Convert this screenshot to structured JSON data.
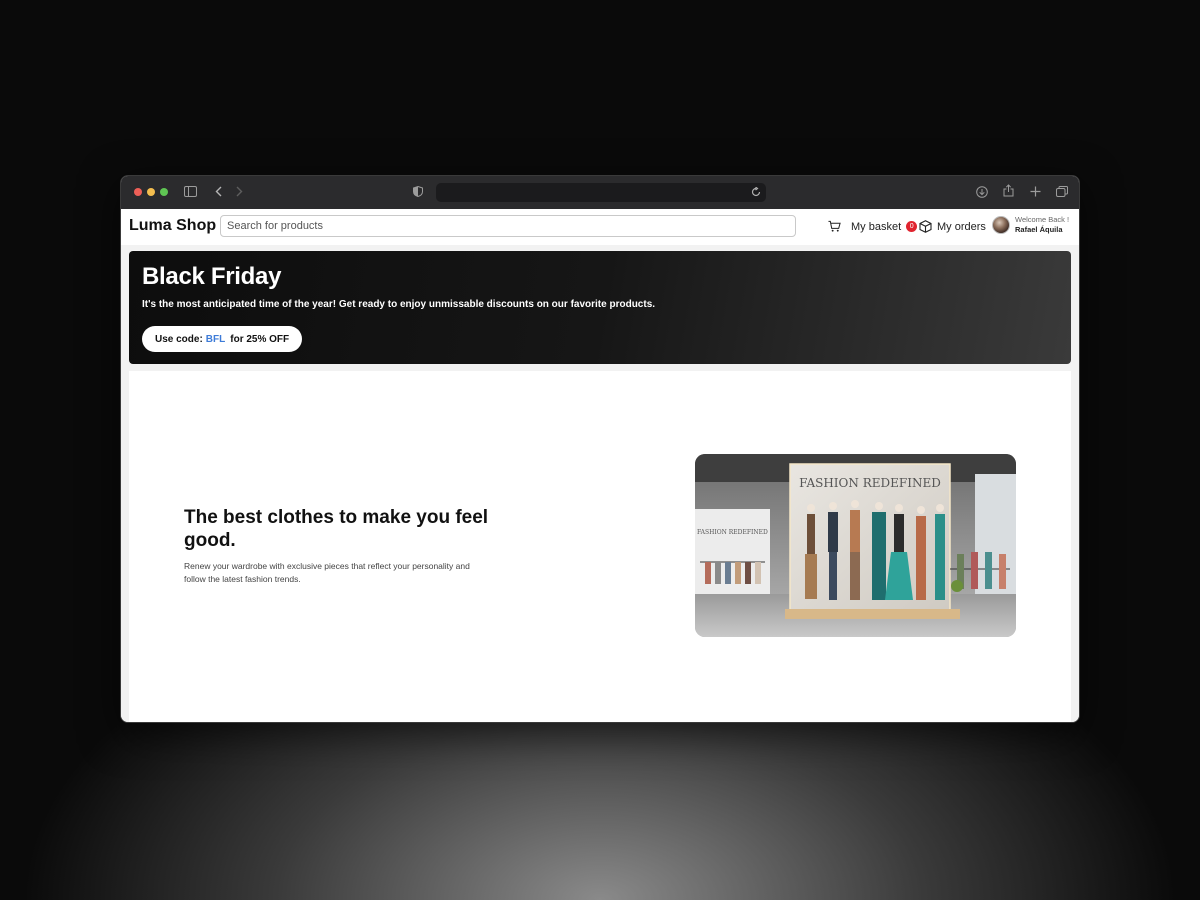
{
  "browser": {
    "controls": [
      "sidebar-icon",
      "back-icon",
      "forward-icon",
      "shield-icon",
      "reload-icon",
      "download-icon",
      "share-icon",
      "plus-icon",
      "tabs-icon"
    ]
  },
  "nav": {
    "logo": "Luma Shop",
    "search_placeholder": "Search for products",
    "basket_label": "My basket",
    "basket_count": "0",
    "orders_label": "My orders",
    "welcome": "Welcome Back !",
    "user_name": "Rafael Áquila"
  },
  "banner": {
    "title": "Black Friday",
    "subtitle": "It's the most anticipated time of the year! Get ready to enjoy unmissable discounts on our favorite products.",
    "promo_prefix": "Use code:",
    "promo_code": "BFL",
    "promo_suffix": "for 25% OFF",
    "code_color": "#3d7bd8"
  },
  "hero": {
    "title": "The best clothes to make you feel good.",
    "description": "Renew your wardrobe with exclusive pieces that reflect your personality and follow the latest fashion trends.",
    "image_sign": "FASHION REDEFINED",
    "image_sign_small": "FASHION REDEFINED"
  }
}
